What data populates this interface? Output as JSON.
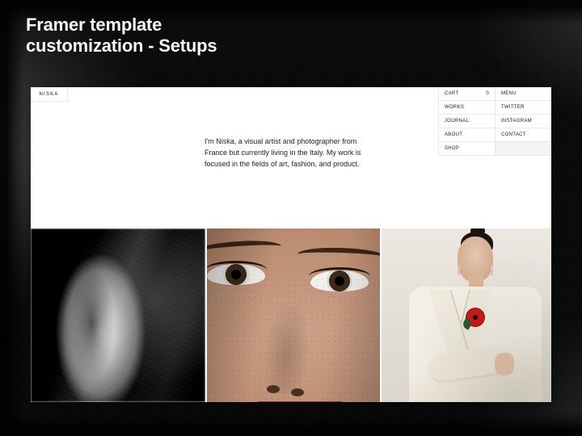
{
  "page": {
    "heading_line1": "Framer template",
    "heading_line2": "customization - Setups"
  },
  "site": {
    "logo": "NISKA",
    "nav": {
      "cart_label": "CART",
      "cart_count": "0",
      "menu": "MENU",
      "works": "WORKS",
      "twitter": "TWITTER",
      "journal": "JOURNAL",
      "instagram": "INSTAGRAM",
      "about": "ABOUT",
      "contact": "CONTACT",
      "shop": "SHOP"
    },
    "intro": "I'm Niska, a visual artist and photographer from France but currently living in the Italy. My work is focused in the fields of art, fashion, and product."
  }
}
